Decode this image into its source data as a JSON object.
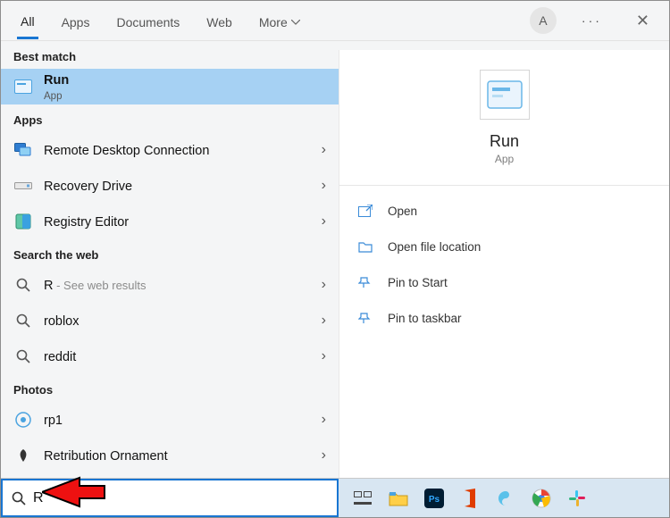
{
  "tabs": {
    "all": "All",
    "apps": "Apps",
    "documents": "Documents",
    "web": "Web",
    "more": "More"
  },
  "avatar_initial": "A",
  "sections": {
    "best_match": "Best match",
    "apps": "Apps",
    "search_web": "Search the web",
    "photos": "Photos"
  },
  "best_match_item": {
    "title": "Run",
    "subtitle": "App"
  },
  "apps_list": [
    {
      "label": "Remote Desktop Connection"
    },
    {
      "label": "Recovery Drive"
    },
    {
      "label": "Registry Editor"
    }
  ],
  "web_list": [
    {
      "label": "R",
      "suffix": " - See web results"
    },
    {
      "label": "roblox"
    },
    {
      "label": "reddit"
    }
  ],
  "photos_list": [
    {
      "label": "rp1"
    },
    {
      "label": "Retribution Ornament"
    }
  ],
  "detail": {
    "title": "Run",
    "subtitle": "App"
  },
  "actions": {
    "open": "Open",
    "open_loc": "Open file location",
    "pin_start": "Pin to Start",
    "pin_task": "Pin to taskbar"
  },
  "search_value": "R",
  "colors": {
    "accent": "#1976d2",
    "selection": "#a6d1f3"
  }
}
